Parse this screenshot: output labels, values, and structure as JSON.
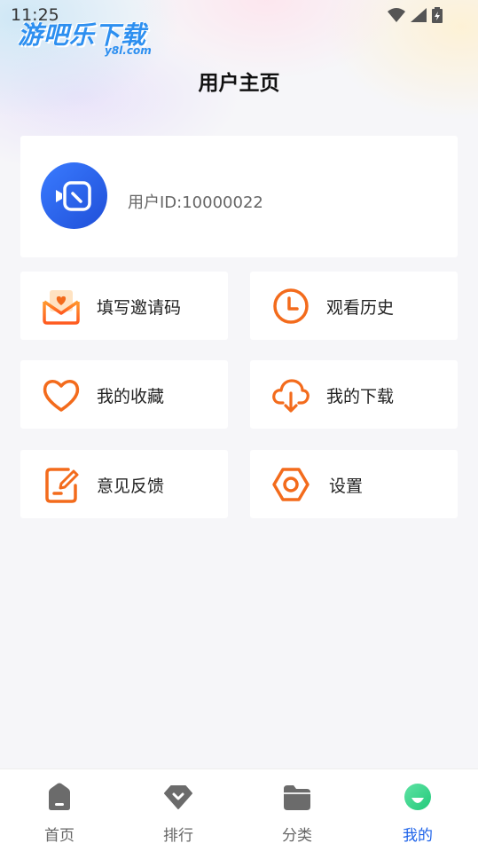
{
  "status_bar": {
    "time": "11:25"
  },
  "logo": {
    "main": "游吧乐下载",
    "sub": "y8l.com"
  },
  "header": {
    "title": "用户主页"
  },
  "profile": {
    "user_id_text": "用户ID:10000022"
  },
  "menu": {
    "invite_code": "填写邀请码",
    "history": "观看历史",
    "favorites": "我的收藏",
    "downloads": "我的下载",
    "feedback": "意见反馈",
    "settings": "设置"
  },
  "bottom_nav": {
    "items": [
      {
        "label": "首页",
        "icon": "home-icon"
      },
      {
        "label": "排行",
        "icon": "ranking-icon"
      },
      {
        "label": "分类",
        "icon": "folder-icon"
      },
      {
        "label": "我的",
        "icon": "profile-icon"
      }
    ],
    "active_index": 3
  },
  "colors": {
    "accent": "#1e63e9",
    "icon_orange": "#f36b1c",
    "nav_icon_inactive": "#6b6b6b",
    "nav_active_green": "#3dd68c"
  }
}
